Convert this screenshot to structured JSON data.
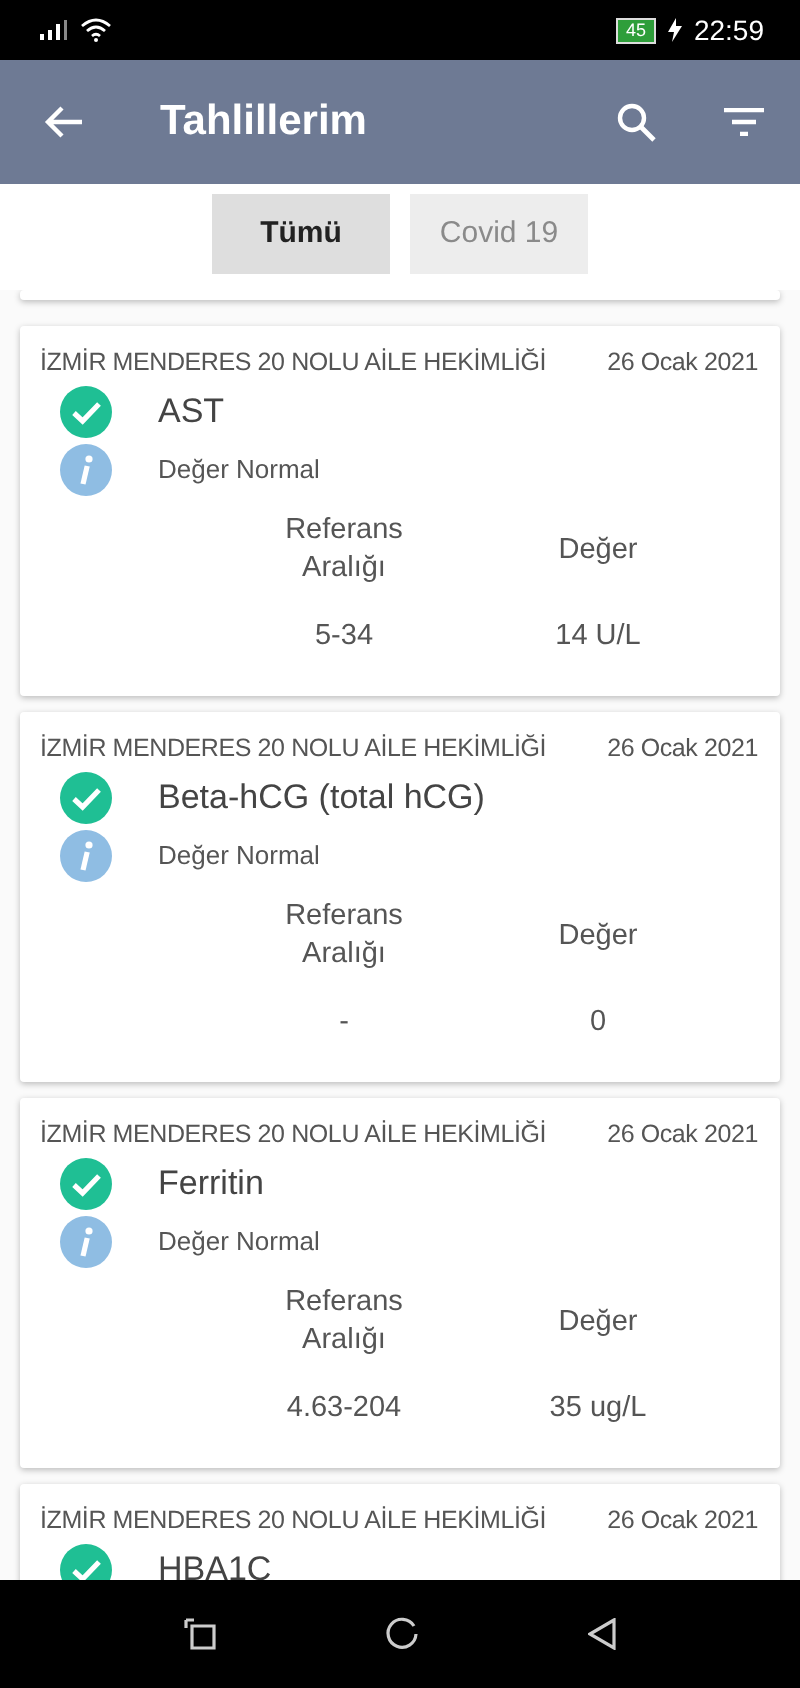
{
  "status_bar": {
    "battery": "45",
    "time": "22:59"
  },
  "app_bar": {
    "title": "Tahlillerim"
  },
  "filters": [
    {
      "label": "Tümü",
      "selected": true
    },
    {
      "label": "Covid 19",
      "selected": false
    }
  ],
  "results": [
    {
      "clinic": "İZMİR MENDERES 20 NOLU AİLE HEKİMLİĞİ",
      "date": "26 Ocak 2021",
      "test": "AST",
      "normal": true,
      "note": "Değer Normal",
      "reference_header": "Referans Aralığı",
      "value_header": "Değer",
      "reference": "5-34",
      "value": "14 U/L"
    },
    {
      "clinic": "İZMİR MENDERES 20 NOLU AİLE HEKİMLİĞİ",
      "date": "26 Ocak 2021",
      "test": "Beta-hCG (total hCG)",
      "normal": true,
      "note": "Değer Normal",
      "reference_header": "Referans Aralığı",
      "value_header": "Değer",
      "reference": "-",
      "value": "0"
    },
    {
      "clinic": "İZMİR MENDERES 20 NOLU AİLE HEKİMLİĞİ",
      "date": "26 Ocak 2021",
      "test": "Ferritin",
      "normal": true,
      "note": "Değer Normal",
      "reference_header": "Referans Aralığı",
      "value_header": "Değer",
      "reference": "4.63-204",
      "value": "35 ug/L"
    },
    {
      "clinic": "İZMİR MENDERES 20 NOLU AİLE HEKİMLİĞİ",
      "date": "26 Ocak 2021",
      "test": "HBA1C",
      "normal": true
    }
  ]
}
